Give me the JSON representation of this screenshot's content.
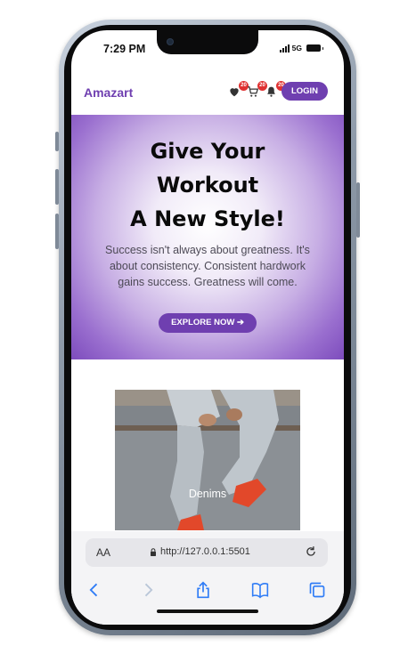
{
  "status_bar": {
    "time": "7:29 PM",
    "network": "5G"
  },
  "nav": {
    "brand": "Amazart",
    "wishlist_count": "20",
    "cart_count": "20",
    "notifications_count": "20",
    "login_label": "LOGIN"
  },
  "hero": {
    "title_line1": "Give Your",
    "title_line2": "Workout",
    "title_line3": "A New Style!",
    "text": "Success isn't always about greatness. It's about consistency. Consistent hardwork gains success. Greatness will come.",
    "cta_label": "EXPLORE NOW ➔"
  },
  "product_card": {
    "label": "Denims"
  },
  "browser": {
    "aa_label": "AA",
    "url": "http://127.0.0.1:5501"
  },
  "colors": {
    "brand": "#6f3fb0",
    "badge": "#e03131",
    "sneaker": "#e2482a"
  }
}
